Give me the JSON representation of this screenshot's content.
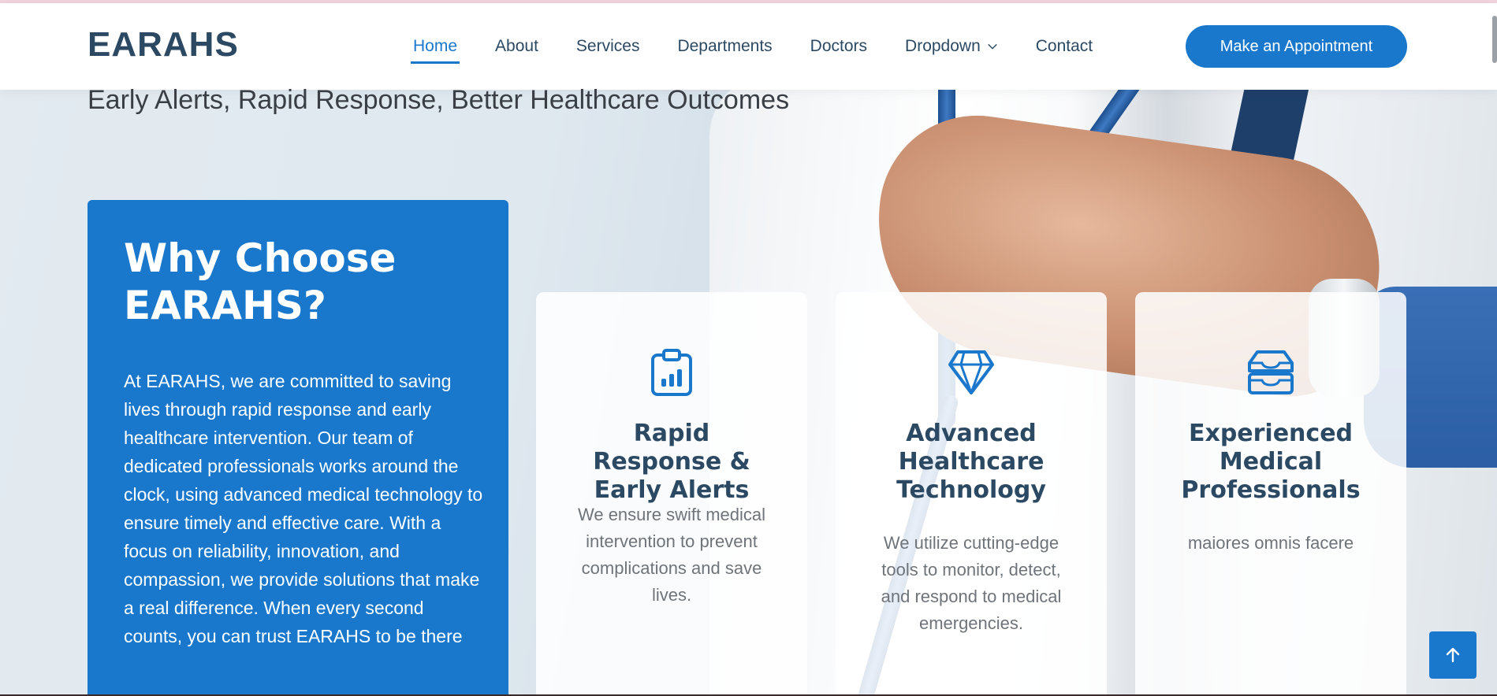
{
  "header": {
    "logo": "EARAHS",
    "nav": [
      {
        "label": "Home",
        "active": true
      },
      {
        "label": "About"
      },
      {
        "label": "Services"
      },
      {
        "label": "Departments"
      },
      {
        "label": "Doctors"
      },
      {
        "label": "Dropdown",
        "icon": "chevron-down-icon"
      },
      {
        "label": "Contact"
      }
    ],
    "cta_label": "Make an Appointment"
  },
  "hero": {
    "tagline": "Early Alerts, Rapid Response, Better Healthcare Outcomes"
  },
  "why": {
    "title": "Why Choose EARAHS?",
    "text": "At EARAHS, we are committed to saving lives through rapid response and early healthcare intervention. Our team of dedicated professionals works around the clock, using advanced medical technology to ensure timely and effective care. With a focus on reliability, innovation, and compassion, we provide solutions that make a real difference. When every second counts, you can trust EARAHS to be there"
  },
  "cards": [
    {
      "icon": "clipboard-chart-icon",
      "title": "Rapid Response & Early Alerts",
      "text": "We ensure swift medical intervention to prevent complications and save lives."
    },
    {
      "icon": "gem-icon",
      "title": "Advanced Healthcare Technology",
      "text": "We utilize cutting-edge tools to monitor, detect, and respond to medical emergencies."
    },
    {
      "icon": "inbox-icon",
      "title": "Experienced Medical Professionals",
      "text": "maiores omnis facere"
    }
  ],
  "colors": {
    "accent": "#1977cc",
    "heading": "#2c4964",
    "body_text": "#6e7479"
  },
  "back_to_top_icon": "arrow-up-icon"
}
